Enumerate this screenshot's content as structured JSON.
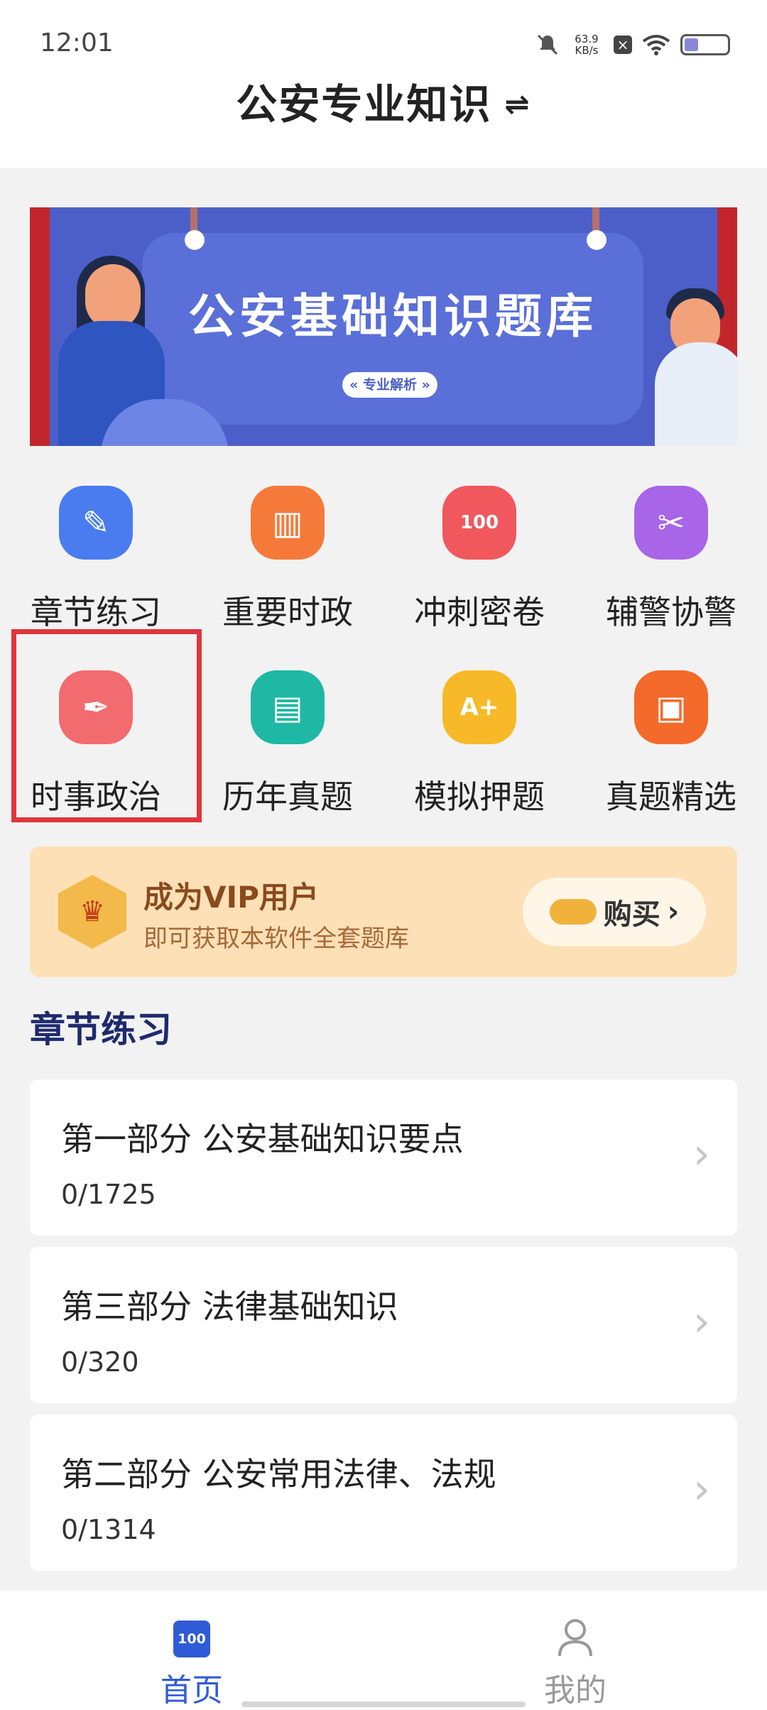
{
  "status": {
    "time": "12:01",
    "speed": "63.9",
    "speed_unit": "KB/s"
  },
  "header": {
    "title": "公安专业知识"
  },
  "banner": {
    "title": "公安基础知识题库",
    "chip": "« 专业解析 »"
  },
  "grid": [
    {
      "label": "章节练习",
      "color": "#4a7cf0",
      "icon": "pencil-icon"
    },
    {
      "label": "重要时政",
      "color": "#f57a3a",
      "icon": "book-icon"
    },
    {
      "label": "冲刺密卷",
      "color": "#f0585e",
      "icon": "score-paper-icon"
    },
    {
      "label": "辅警协警",
      "color": "#a865e8",
      "icon": "tools-icon"
    },
    {
      "label": "时事政治",
      "color": "#f26b6e",
      "icon": "pen-nib-icon"
    },
    {
      "label": "历年真题",
      "color": "#1fb8a4",
      "icon": "document-icon"
    },
    {
      "label": "模拟押题",
      "color": "#f7b928",
      "icon": "grade-paper-icon"
    },
    {
      "label": "真题精选",
      "color": "#f36a2a",
      "icon": "chart-board-icon"
    }
  ],
  "vip": {
    "title": "成为VIP用户",
    "subtitle": "即可获取本软件全套题库",
    "buy_label": "购买"
  },
  "section": {
    "title": "章节练习"
  },
  "chapters": [
    {
      "title": "第一部分 公安基础知识要点",
      "progress": "0/1725"
    },
    {
      "title": "第三部分 法律基础知识",
      "progress": "0/320"
    },
    {
      "title": "第二部分 公安常用法律、法规",
      "progress": "0/1314"
    }
  ],
  "nav": {
    "home": {
      "label": "首页",
      "icon_text": "100",
      "color": "#2f5bd6"
    },
    "mine": {
      "label": "我的",
      "color": "#999999"
    }
  }
}
